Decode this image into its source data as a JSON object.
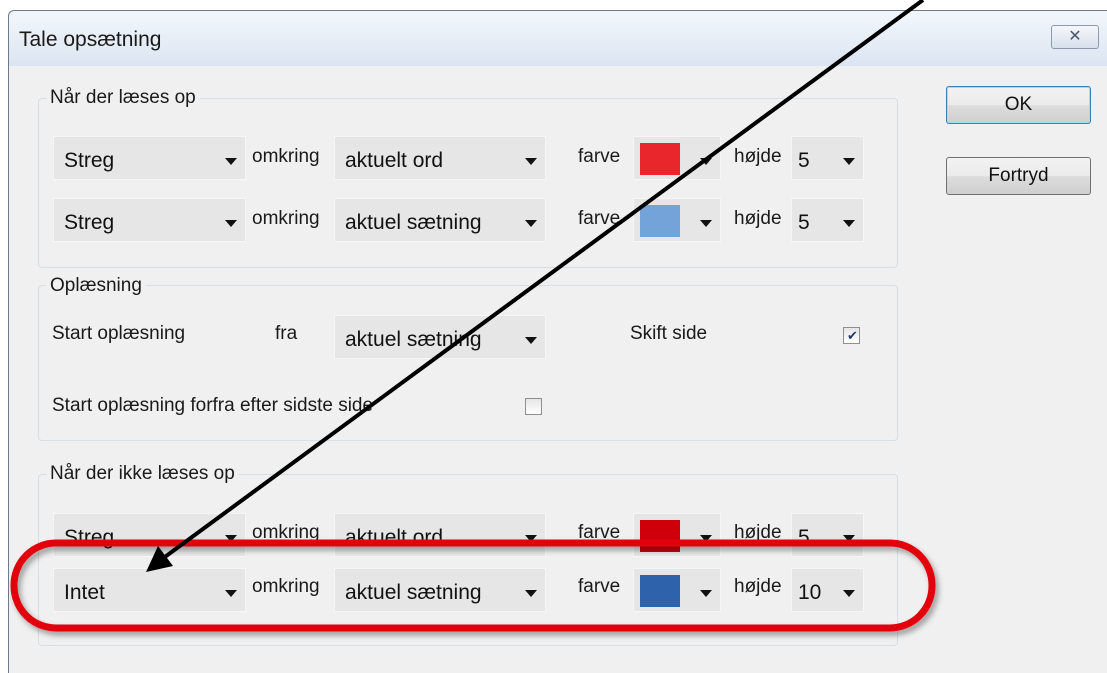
{
  "window": {
    "title": "Tale opsætning",
    "close_glyph": "✕"
  },
  "buttons": {
    "ok": "OK",
    "cancel": "Fortryd"
  },
  "groups": {
    "reading": "Når der læses op",
    "playback": "Oplæsning",
    "not_reading": "Når der ikke læses op"
  },
  "labels": {
    "around": "omkring",
    "color": "farve",
    "height": "højde"
  },
  "reading_rows": [
    {
      "style": "Streg",
      "scope": "aktuelt ord",
      "color": "#e8262b",
      "height": "5"
    },
    {
      "style": "Streg",
      "scope": "aktuel sætning",
      "color": "#74a3d9",
      "height": "5"
    }
  ],
  "not_reading_rows": [
    {
      "style": "Streg",
      "scope": "aktuelt ord",
      "color": "#d0000b",
      "height": "5"
    },
    {
      "style": "Intet",
      "scope": "aktuel sætning",
      "color": "#2e63ab",
      "height": "10"
    }
  ],
  "playback": {
    "start_label": "Start oplæsning",
    "from_label": "fra",
    "from_value": "aktuel sætning",
    "switch_page_label": "Skift side",
    "switch_page_checked": true,
    "restart_label": "Start oplæsning forfra efter sidste side",
    "restart_checked": false
  },
  "annotation": {
    "highlight_color": "#e3000f",
    "arrow_color": "#000000"
  }
}
